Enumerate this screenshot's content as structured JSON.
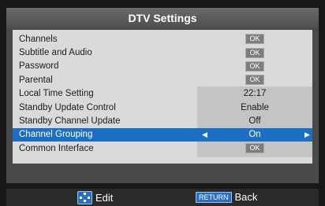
{
  "window": {
    "title": "DTV Settings"
  },
  "menu": {
    "items": [
      {
        "label": "Channels",
        "value": "OK",
        "kind": "button"
      },
      {
        "label": "Subtitle and Audio",
        "value": "OK",
        "kind": "button"
      },
      {
        "label": "Password",
        "value": "OK",
        "kind": "button"
      },
      {
        "label": "Parental",
        "value": "OK",
        "kind": "button"
      },
      {
        "label": "Local Time Setting",
        "value": "22:17",
        "kind": "text"
      },
      {
        "label": "Standby Update Control",
        "value": "Enable",
        "kind": "text"
      },
      {
        "label": "Standby Channel Update",
        "value": "Off",
        "kind": "text"
      },
      {
        "label": "Channel Grouping",
        "value": "On",
        "kind": "selector",
        "selected": true
      },
      {
        "label": "Common Interface",
        "value": "OK",
        "kind": "button"
      }
    ]
  },
  "footer": {
    "edit_label": "Edit",
    "return_key": "RETURN",
    "back_label": "Back"
  },
  "colors": {
    "highlight": "#1d6fc4",
    "panel": "#dadada",
    "title": "#5a5a5a"
  },
  "icons": {
    "nav": "nav-pad-icon",
    "left": "arrow-left-icon",
    "right": "arrow-right-icon"
  }
}
